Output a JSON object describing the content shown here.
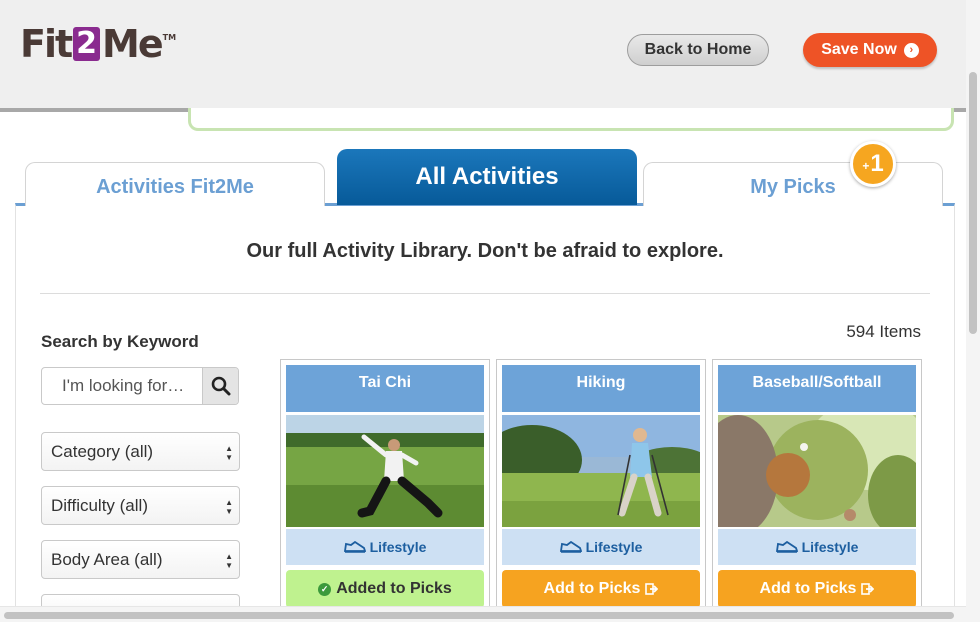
{
  "header": {
    "logo_prefix": "Fit",
    "logo_number": "2",
    "logo_suffix": "Me",
    "logo_tm": "TM",
    "back_label": "Back to Home",
    "save_label": "Save Now"
  },
  "tabs": [
    {
      "label": "Activities Fit2Me",
      "active": false
    },
    {
      "label": "All Activities",
      "active": true
    },
    {
      "label": "My Picks",
      "active": false
    }
  ],
  "picks_badge": {
    "plus": "+",
    "count": "1"
  },
  "tagline": "Our full Activity Library. Don't be afraid to explore.",
  "filters": {
    "search_label": "Search by Keyword",
    "search_placeholder": "I'm looking for…",
    "category": "Category (all)",
    "difficulty": "Difficulty (all)",
    "body_area": "Body Area (all)"
  },
  "items_count": "594 Items",
  "colors": {
    "accent_blue": "#1b77bb",
    "tab_text": "#6b9fd3",
    "save_orange": "#ee5326",
    "add_orange": "#f6a320",
    "added_green": "#bff28f",
    "logo_purple": "#8a2b8f"
  },
  "cards": [
    {
      "title": "Tai Chi",
      "category": "Lifestyle",
      "action": "Added to Picks",
      "state": "added"
    },
    {
      "title": "Hiking",
      "category": "Lifestyle",
      "action": "Add to Picks",
      "state": "add"
    },
    {
      "title": "Baseball/Softball",
      "category": "Lifestyle",
      "action": "Add to Picks",
      "state": "add"
    }
  ]
}
